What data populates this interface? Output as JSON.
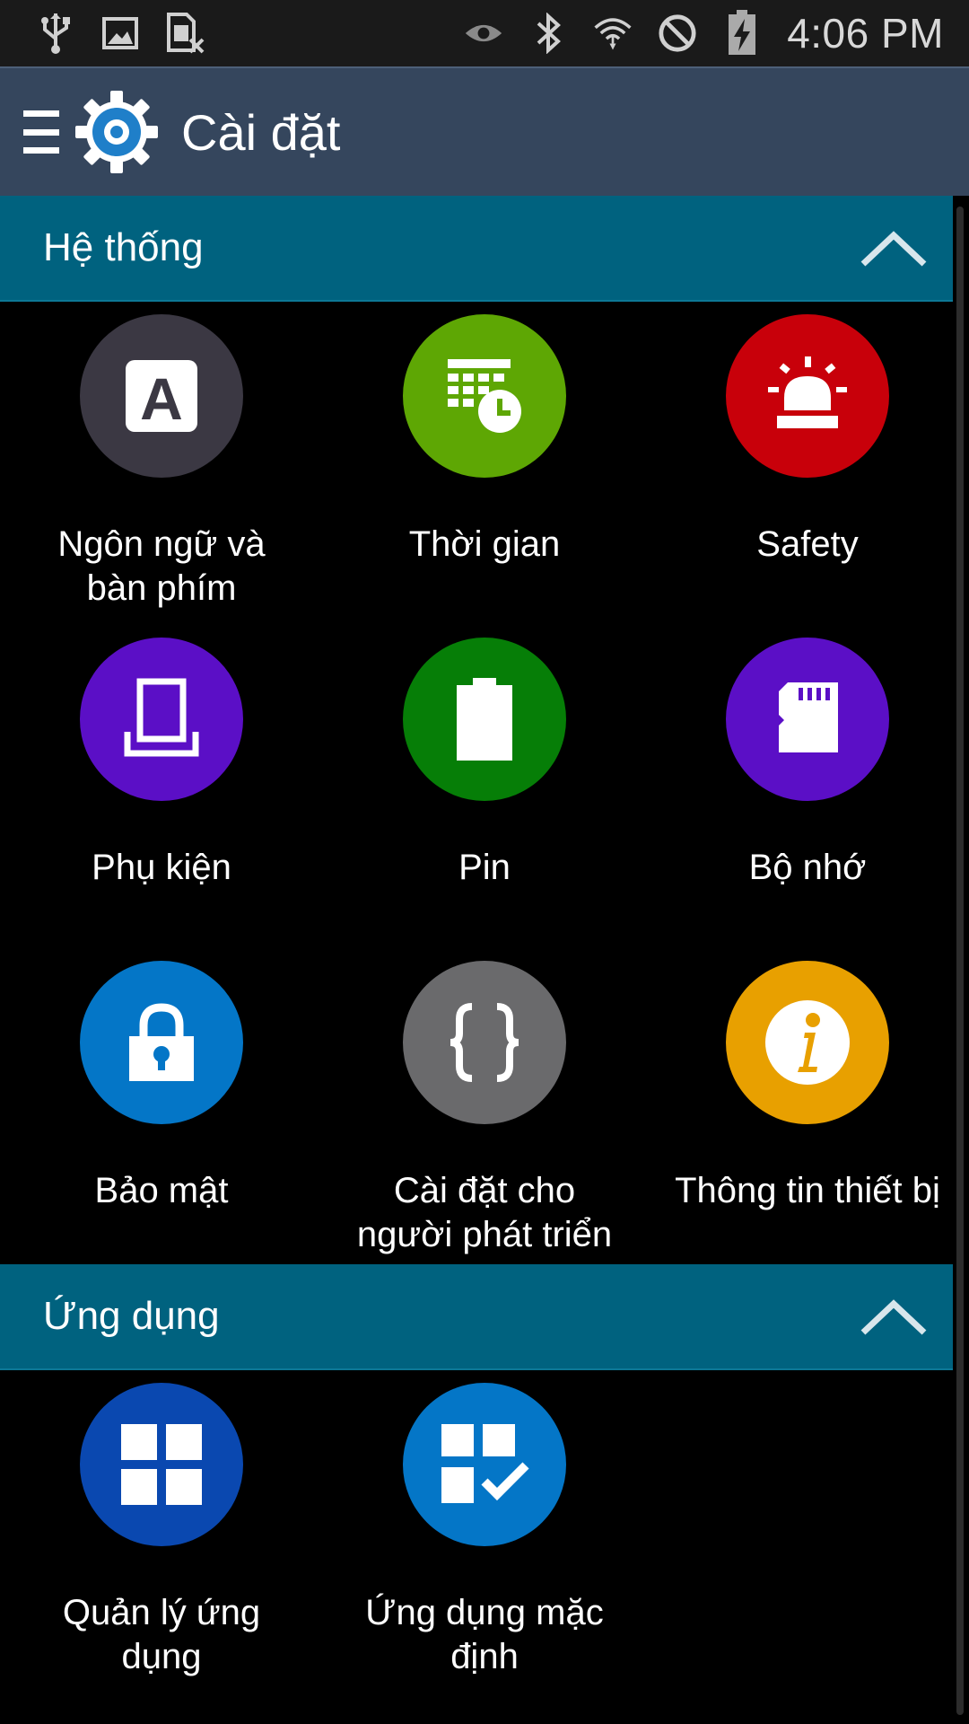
{
  "status_bar": {
    "time": "4:06 PM",
    "left_icons": [
      "usb-icon",
      "image-icon",
      "sim-disabled-icon"
    ],
    "right_icons": [
      "smart-stay-eye-icon",
      "bluetooth-icon",
      "wifi-icon",
      "blocked-icon",
      "battery-charging-icon"
    ]
  },
  "action_bar": {
    "title": "Cài đặt",
    "menu_icon": "menu-icon",
    "app_icon": "settings-gear-icon"
  },
  "sections": [
    {
      "title": "Hệ thống",
      "items": [
        {
          "label": "Ngôn ngữ và bàn phím",
          "icon": "language-keyboard-icon",
          "color": "#3b3843"
        },
        {
          "label": "Thời gian",
          "icon": "calendar-clock-icon",
          "color": "#5ea704"
        },
        {
          "label": "Safety",
          "icon": "alarm-light-icon",
          "color": "#c8000a"
        },
        {
          "label": "Phụ kiện",
          "icon": "accessory-icon",
          "color": "#5b0fc6"
        },
        {
          "label": "Pin",
          "icon": "battery-icon",
          "color": "#067e07"
        },
        {
          "label": "Bộ nhớ",
          "icon": "sd-card-icon",
          "color": "#5b0fc6"
        },
        {
          "label": "Bảo mật",
          "icon": "padlock-icon",
          "color": "#0476c7"
        },
        {
          "label": "Cài đặt cho người phát triển",
          "icon": "braces-icon",
          "color": "#6a6a6c"
        },
        {
          "label": "Thông tin thiết bị",
          "icon": "info-icon",
          "color": "#e8a000"
        }
      ]
    },
    {
      "title": "Ứng dụng",
      "items": [
        {
          "label": "Quản lý ứng dụng",
          "icon": "app-grid-icon",
          "color": "#0a48b0"
        },
        {
          "label": "Ứng dụng mặc định",
          "icon": "default-apps-check-icon",
          "color": "#0476c7"
        }
      ]
    }
  ]
}
